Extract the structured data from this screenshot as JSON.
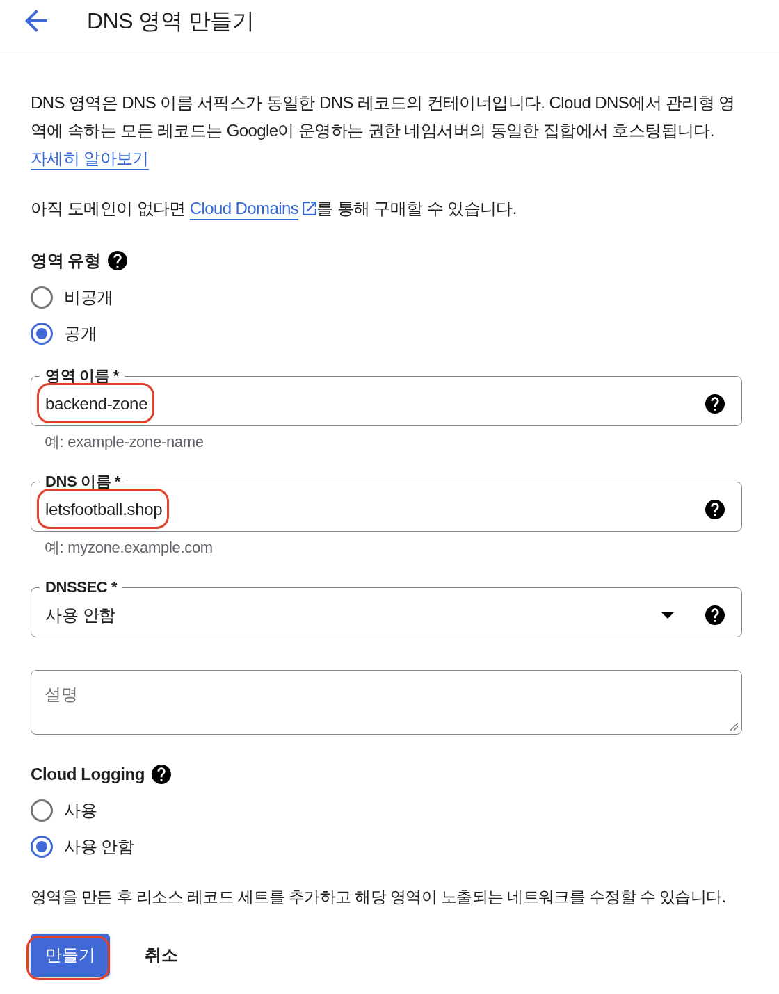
{
  "header": {
    "title": "DNS 영역 만들기"
  },
  "intro": {
    "text": "DNS 영역은 DNS 이름 서픽스가 동일한 DNS 레코드의 컨테이너입니다. Cloud DNS에서 관리형 영역에 속하는 모든 레코드는 Google이 운영하는 권한 네임서버의 동일한 집합에서 호스팅됩니다.",
    "link": "자세히 알아보기"
  },
  "domain_note": {
    "before": "아직 도메인이 없다면 ",
    "link": "Cloud Domains",
    "after": "를 통해 구매할 수 있습니다."
  },
  "zone_type": {
    "label": "영역 유형",
    "options": [
      {
        "label": "비공개",
        "selected": false
      },
      {
        "label": "공개",
        "selected": true
      }
    ]
  },
  "fields": [
    {
      "kind": "text",
      "label": "영역 이름 *",
      "value": "backend-zone",
      "hint": "예: example-zone-name",
      "highlighted": true
    },
    {
      "kind": "text",
      "label": "DNS 이름 *",
      "value": "letsfootball.shop",
      "hint": "예: myzone.example.com",
      "highlighted": true
    },
    {
      "kind": "select",
      "label": "DNSSEC *",
      "value": "사용 안함",
      "highlighted": false
    },
    {
      "kind": "textarea",
      "placeholder": "설명",
      "highlighted": false
    }
  ],
  "cloud_logging": {
    "label": "Cloud Logging",
    "options": [
      {
        "label": "사용",
        "selected": false
      },
      {
        "label": "사용 안함",
        "selected": true
      }
    ]
  },
  "note": "영역을 만든 후 리소스 레코드 세트를 추가하고 해당 영역이 노출되는 네트워크를 수정할 수 있습니다.",
  "buttons": [
    {
      "kind": "primary",
      "label": "만들기",
      "highlighted": true
    },
    {
      "kind": "text",
      "label": "취소",
      "highlighted": false
    }
  ]
}
